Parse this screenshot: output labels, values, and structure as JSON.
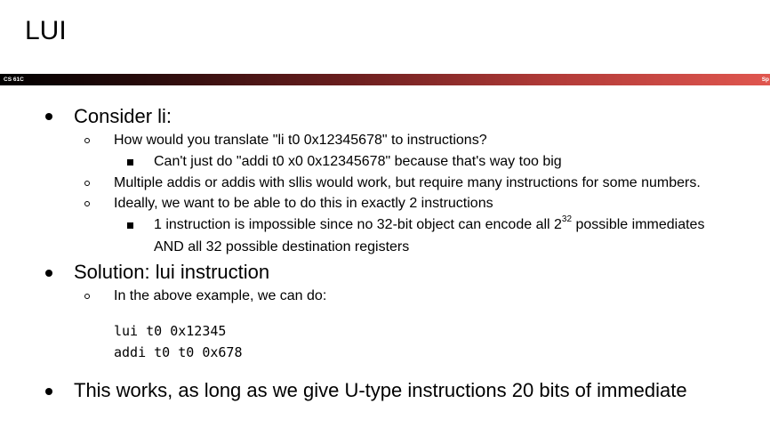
{
  "slide": {
    "title": "LUI",
    "course": "CS 61C",
    "corner": "Sp"
  },
  "content": {
    "b1_consider": "Consider li:",
    "b2_translate": "How would you translate \"li t0 0x12345678\" to instructions?",
    "b3_too_big": "Can't just do \"addi t0 x0 0x12345678\" because that's way too big",
    "b2_multiple": "Multiple addis or addis with sllis would work, but require many instructions for some numbers.",
    "b2_ideally": "Ideally, we want to be able to do this in exactly 2 instructions",
    "b3_impossible_a": "1 instruction is impossible since no 32-bit object can encode all 2",
    "b3_impossible_sup": "32",
    "b3_impossible_b": " possible immediates",
    "b3_impossible_line2": "AND all 32 possible destination registers",
    "b1_solution": "Solution: lui instruction",
    "b2_example": "In the above example, we can do:",
    "code_line1": "lui t0 0x12345",
    "code_line2": "addi t0 t0 0x678",
    "b1_works": "This works, as long as we give U-type instructions 20 bits of immediate"
  }
}
